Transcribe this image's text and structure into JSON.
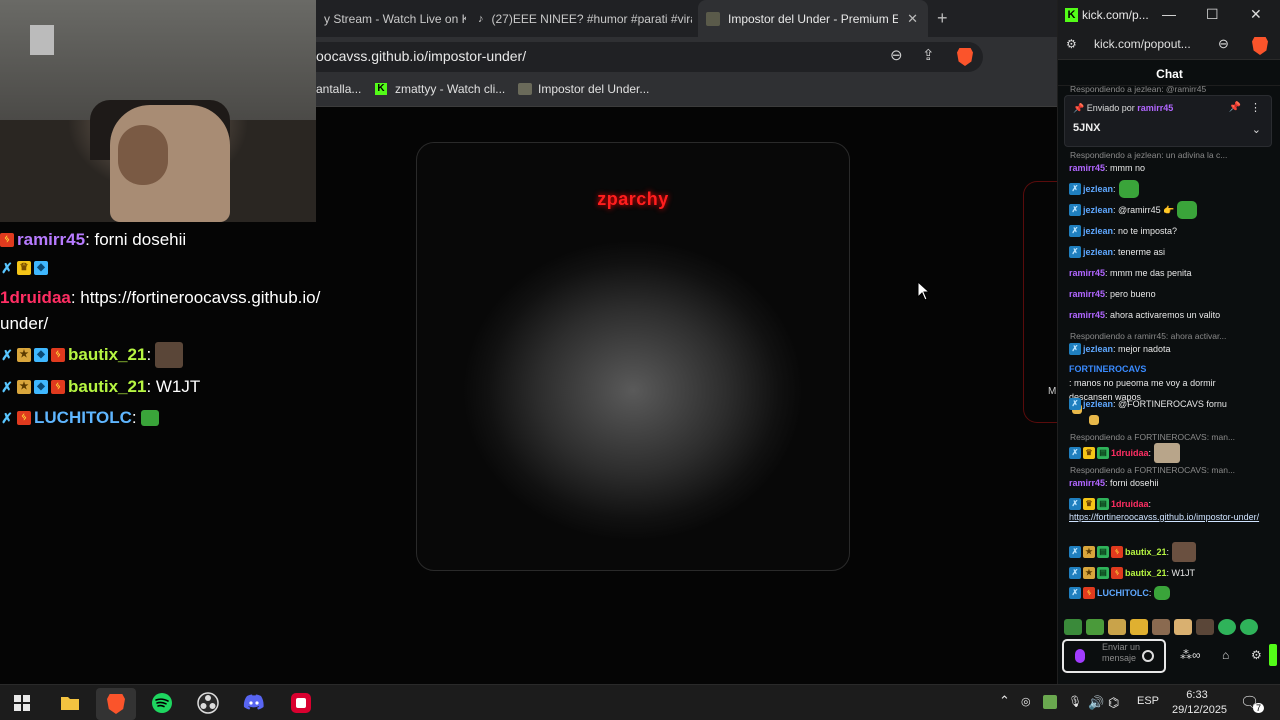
{
  "browser": {
    "tabs": [
      {
        "title": "y Stream - Watch Live on K",
        "icon": "kick-icon"
      },
      {
        "title": "(27)EEE NINEE? #humor #parati #vira",
        "icon": "tiktok-icon"
      },
      {
        "title": "Impostor del Under - Premium E",
        "icon": "game-icon",
        "active": true
      }
    ],
    "url": "oocavss.github.io/impostor-under/",
    "bookmarks": [
      {
        "label": "antalla...",
        "icon": "folder"
      },
      {
        "label": "zmattyy - Watch cli...",
        "icon": "kick-icon"
      },
      {
        "label": "Impostor del Under...",
        "icon": "image-icon"
      }
    ]
  },
  "game": {
    "card_title": "zparchy",
    "side_label": "M"
  },
  "overlay_chat": [
    {
      "badges": [
        "zig"
      ],
      "user": "ramirr45",
      "user_color": "#b77bff",
      "text": ": forni dosehii"
    },
    {
      "badges": [
        "sword",
        "crown",
        "cube"
      ],
      "user": "",
      "user_color": "#ffffff",
      "text": ""
    },
    {
      "badges": [],
      "user": "1druidaa",
      "user_color": "#ff2e63",
      "text": ": https://fortineroocavss.github.io/"
    },
    {
      "badges": [],
      "user": "",
      "user_color": "#ffffff",
      "text": "under/"
    },
    {
      "badges": [
        "sword",
        "sub",
        "cube",
        "zig"
      ],
      "user": "bautix_21",
      "user_color": "#b6f542",
      "text": ":"
    },
    {
      "badges": [
        "sword",
        "sub",
        "cube",
        "zig"
      ],
      "user": "bautix_21",
      "user_color": "#b6f542",
      "text": ": W1JT"
    },
    {
      "badges": [
        "sword",
        "zig"
      ],
      "user": "LUCHITOLC",
      "user_color": "#5fb6ff",
      "text": ":"
    }
  ],
  "kick": {
    "window_title": "kick.com/p...",
    "address": "kick.com/popout...",
    "header": "Chat",
    "top_reply": "Respondiendo a jezlean: @ramirr45",
    "pinned": {
      "prefix": "Enviado por",
      "user": "ramirr45",
      "text": "5JNX"
    },
    "messages": [
      {
        "reply": "Respondiendo a jezlean: un adivina la c...",
        "badges": [],
        "user": "ramirr45",
        "color": "#b166ff",
        "text": ": mmm no",
        "emote": ""
      },
      {
        "reply": "",
        "badges": [
          "sword"
        ],
        "user": "jezlean",
        "color": "#5fa8ff",
        "text": ":",
        "emote": "green"
      },
      {
        "reply": "",
        "badges": [
          "sword"
        ],
        "user": "jezlean",
        "color": "#5fa8ff",
        "text": ": @ramirr45 👉",
        "emote": "green"
      },
      {
        "reply": "",
        "badges": [
          "sword"
        ],
        "user": "jezlean",
        "color": "#5fa8ff",
        "text": ": no te imposta?",
        "emote": ""
      },
      {
        "reply": "",
        "badges": [
          "sword"
        ],
        "user": "jezlean",
        "color": "#5fa8ff",
        "text": ": tenerme asi",
        "emote": ""
      },
      {
        "reply": "",
        "badges": [],
        "user": "ramirr45",
        "color": "#b166ff",
        "text": ": mmm me das penita",
        "emote": ""
      },
      {
        "reply": "",
        "badges": [],
        "user": "ramirr45",
        "color": "#b166ff",
        "text": ": pero bueno",
        "emote": ""
      },
      {
        "reply": "",
        "badges": [],
        "user": "ramirr45",
        "color": "#b166ff",
        "text": ": ahora activaremos un valito",
        "emote": ""
      },
      {
        "reply": "Respondiendo a ramirr45: ahora activar...",
        "badges": [
          "sword"
        ],
        "user": "jezlean",
        "color": "#5fa8ff",
        "text": ": mejor nadota",
        "emote": ""
      },
      {
        "reply": "",
        "badges": [],
        "user": "FORTINEROCAVS",
        "color": "#3a8bff",
        "text": ": manos no pueoma me voy a dormir descansen wapos",
        "emote": "hand"
      },
      {
        "reply": "",
        "badges": [
          "sword"
        ],
        "user": "jezlean",
        "color": "#5fa8ff",
        "text": ": @FORTINEROCAVS fornu",
        "emote": "hand"
      },
      {
        "reply": "Respondiendo a FORTINEROCAVS: man...",
        "badges": [
          "sword",
          "crown",
          "sub"
        ],
        "user": "1druidaa",
        "color": "#ff2e63",
        "text": ":",
        "emote": "cat"
      },
      {
        "reply": "Respondiendo a FORTINEROCAVS: man...",
        "badges": [],
        "user": "ramirr45",
        "color": "#b166ff",
        "text": ": forni dosehii",
        "emote": ""
      },
      {
        "reply": "",
        "badges": [
          "sword",
          "crown",
          "sub"
        ],
        "user": "1druidaa",
        "color": "#ff2e63",
        "text": ":",
        "emote": "",
        "link": "https://fortineroocavss.github.io/impostor-under/"
      },
      {
        "reply": "",
        "badges": [
          "sword",
          "gold",
          "sub",
          "zig"
        ],
        "user": "bautix_21",
        "color": "#b6f542",
        "text": ":",
        "emote": "brown"
      },
      {
        "reply": "",
        "badges": [
          "sword",
          "gold",
          "sub",
          "zig"
        ],
        "user": "bautix_21",
        "color": "#b6f542",
        "text": ": W1JT",
        "emote": ""
      },
      {
        "reply": "",
        "badges": [
          "sword",
          "zig"
        ],
        "user": "LUCHITOLC",
        "color": "#5fa8ff",
        "text": ":",
        "emote": "green"
      }
    ],
    "input_placeholder": "Enviar un mensaje"
  },
  "taskbar": {
    "apps": [
      "windows-start",
      "file-explorer",
      "brave",
      "spotify",
      "obs",
      "discord",
      "app-red"
    ],
    "language": "ESP",
    "time": "6:33",
    "date": "29/12/2025",
    "notification_count": "7"
  },
  "colors": {
    "kick_green": "#53fc18",
    "brave_orange": "#fb542b",
    "accent_red": "#ff1e1e"
  }
}
